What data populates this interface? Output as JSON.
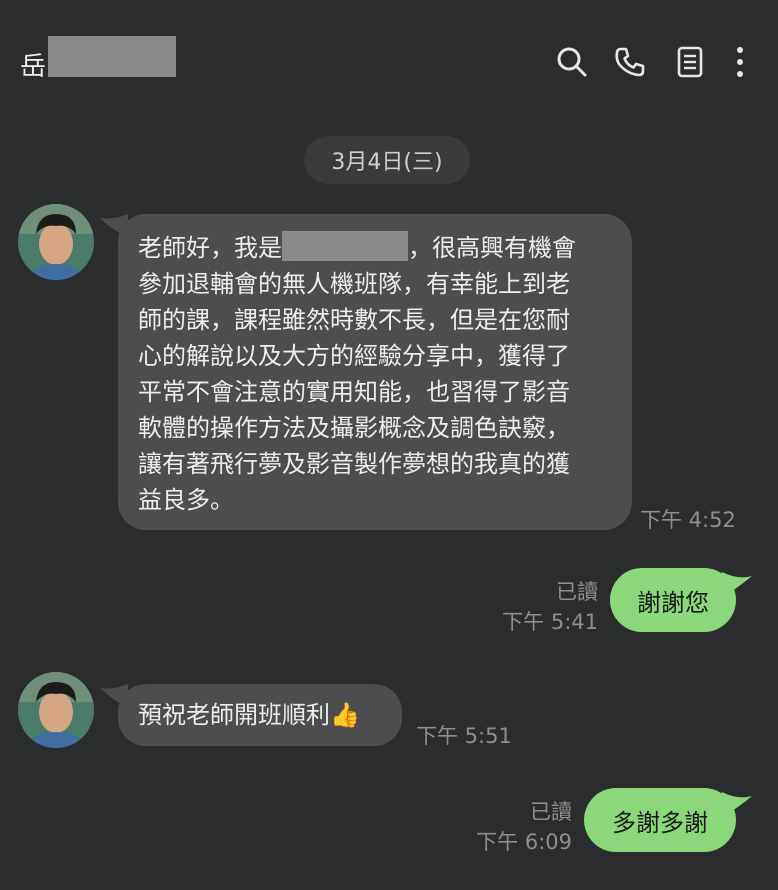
{
  "header": {
    "title": "岳"
  },
  "date_divider": "3月4日(三)",
  "messages": [
    {
      "direction": "in",
      "line1_prefix": "老師好，我是",
      "line1_suffix": "，很高興有機會",
      "lines": [
        "參加退輔會的無人機班隊，有幸能上到老",
        "師的課，課程雖然時數不長，但是在您耐",
        "心的解說以及大方的經驗分享中，獲得了",
        "平常不會注意的實用知能，也習得了影音",
        "軟體的操作方法及攝影概念及調色訣竅，",
        "讓有著飛行夢及影音製作夢想的我真的獲",
        "益良多。"
      ],
      "time": "下午 4:52"
    },
    {
      "direction": "out",
      "text": "謝謝您",
      "read": "已讀",
      "time": "下午 5:41"
    },
    {
      "direction": "in",
      "text": "預祝老師開班順利👍",
      "time": "下午 5:51"
    },
    {
      "direction": "out",
      "text": "多謝多謝",
      "read": "已讀",
      "time": "下午 6:09"
    }
  ]
}
